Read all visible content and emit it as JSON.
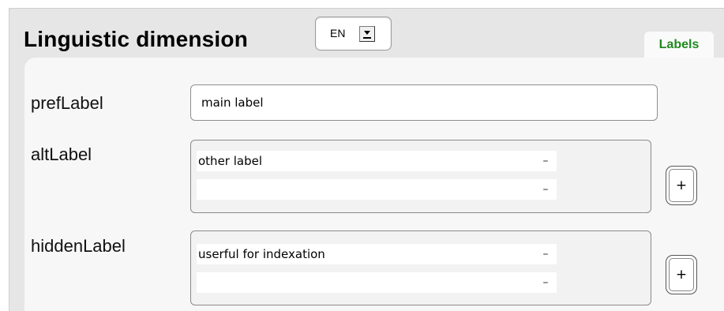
{
  "header": {
    "title": "Linguistic dimension",
    "language": "EN",
    "tab_label": "Labels"
  },
  "fields": {
    "pref": {
      "label": "prefLabel",
      "value": "main label"
    },
    "alt": {
      "label": "altLabel",
      "rows": [
        {
          "value": "other label",
          "remove_label": "–"
        },
        {
          "value": "",
          "remove_label": "–"
        }
      ],
      "add_label": "+"
    },
    "hidden": {
      "label": "hiddenLabel",
      "rows": [
        {
          "value": "userful for indexation",
          "remove_label": "–"
        },
        {
          "value": "",
          "remove_label": "–"
        }
      ],
      "add_label": "+"
    }
  },
  "colors": {
    "tab_text": "#1e8a1e",
    "panel_bg": "#f7f7f7",
    "outer_bg": "#e6e6e6"
  }
}
